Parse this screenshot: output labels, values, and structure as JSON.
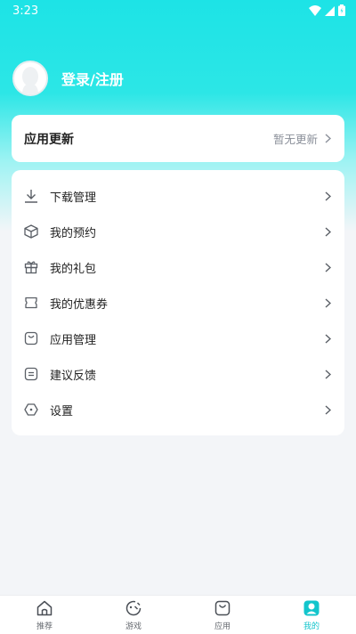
{
  "status_bar": {
    "time": "3:23"
  },
  "profile": {
    "login_label": "登录/注册"
  },
  "update_card": {
    "title": "应用更新",
    "status": "暂无更新"
  },
  "menu": {
    "items": [
      {
        "label": "下载管理",
        "icon": "download-icon"
      },
      {
        "label": "我的预约",
        "icon": "box-icon"
      },
      {
        "label": "我的礼包",
        "icon": "gift-icon"
      },
      {
        "label": "我的优惠券",
        "icon": "coupon-icon"
      },
      {
        "label": "应用管理",
        "icon": "app-bag-icon"
      },
      {
        "label": "建议反馈",
        "icon": "feedback-icon"
      },
      {
        "label": "设置",
        "icon": "settings-icon"
      }
    ]
  },
  "tabs": [
    {
      "label": "推荐",
      "icon": "home-icon",
      "active": false
    },
    {
      "label": "游戏",
      "icon": "game-icon",
      "active": false
    },
    {
      "label": "应用",
      "icon": "bag-icon",
      "active": false
    },
    {
      "label": "我的",
      "icon": "user-icon",
      "active": true
    }
  ],
  "colors": {
    "accent": "#12c5cc",
    "hero_top": "#1de3e6",
    "background": "#f3f5f8"
  }
}
